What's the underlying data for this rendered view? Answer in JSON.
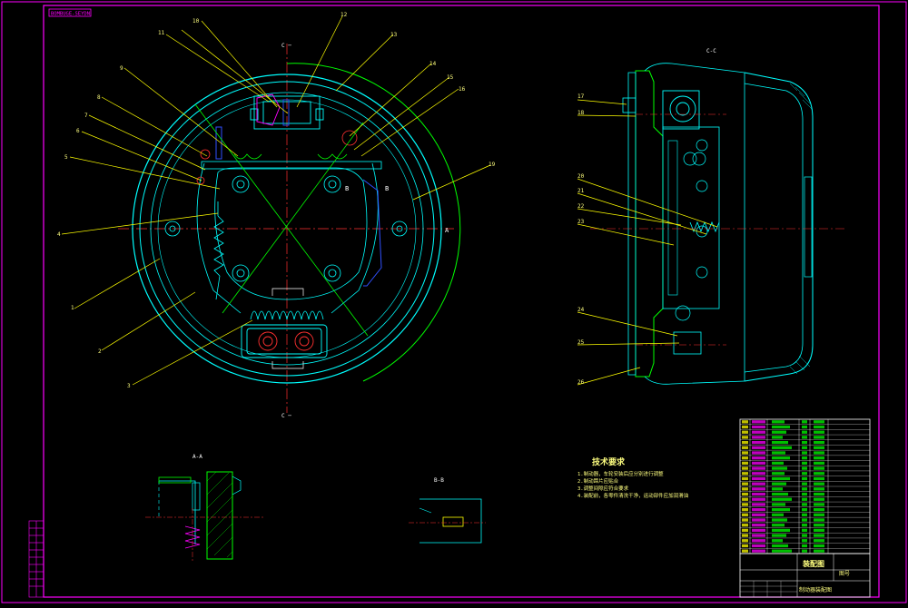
{
  "title_stamp": "BOMBUGE-SEYDN",
  "colors": {
    "bg": "#000000",
    "frame": "#ff00ff",
    "leader": "#ffff00",
    "outline": "#00ffff",
    "green": "#00ff00",
    "red": "#ff3030",
    "blue": "#3050ff",
    "white": "#ffffff",
    "label": "#ffff80"
  },
  "main_view": {
    "section_mark_top": "C ─",
    "section_mark_bottom": "C ─",
    "mark_b_left": "B",
    "mark_b_right": "B",
    "mark_a_right": "A",
    "callouts": [
      {
        "id": "c1",
        "text": "1"
      },
      {
        "id": "c2",
        "text": "2"
      },
      {
        "id": "c3",
        "text": "3"
      },
      {
        "id": "c4",
        "text": "4"
      },
      {
        "id": "c5",
        "text": "5"
      },
      {
        "id": "c6",
        "text": "6"
      },
      {
        "id": "c7",
        "text": "7"
      },
      {
        "id": "c8",
        "text": "8"
      },
      {
        "id": "c9",
        "text": "9"
      },
      {
        "id": "c10",
        "text": "10"
      },
      {
        "id": "c11",
        "text": "11"
      },
      {
        "id": "c12",
        "text": "12"
      },
      {
        "id": "c13",
        "text": "13"
      },
      {
        "id": "c14",
        "text": "14"
      },
      {
        "id": "c15",
        "text": "15"
      },
      {
        "id": "c16",
        "text": "16"
      },
      {
        "id": "c19",
        "text": "19"
      }
    ]
  },
  "side_view": {
    "title": "C-C",
    "callouts": [
      {
        "id": "s17",
        "text": "17"
      },
      {
        "id": "s18",
        "text": "18"
      },
      {
        "id": "s20",
        "text": "20"
      },
      {
        "id": "s21",
        "text": "21"
      },
      {
        "id": "s22",
        "text": "22"
      },
      {
        "id": "s23",
        "text": "23"
      },
      {
        "id": "s24",
        "text": "24"
      },
      {
        "id": "s25",
        "text": "25"
      },
      {
        "id": "s26",
        "text": "26"
      }
    ]
  },
  "section_aa": {
    "title": "A-A"
  },
  "section_bb": {
    "title": "B-B"
  },
  "tech_req": {
    "title": "技术要求",
    "lines": [
      "1.制动器，车轮安装后应分别进行调整",
      "2.制动蹄片应贴合",
      "3.调整间隙应符合要求",
      "4.装配前，各零件清洗干净，运动部件应加润滑油"
    ]
  },
  "title_block": {
    "drawing_name": "装配图",
    "company": "制动器装配图",
    "stamp": "图号"
  }
}
